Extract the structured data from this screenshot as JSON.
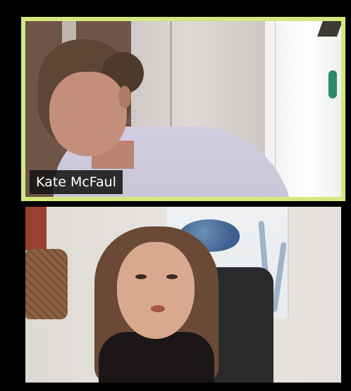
{
  "app": {
    "view": "gallery"
  },
  "participants": [
    {
      "name": "Kate McFaul",
      "active_speaker": true,
      "highlight_color": "#d4e87f"
    },
    {
      "name": "",
      "active_speaker": false
    }
  ]
}
